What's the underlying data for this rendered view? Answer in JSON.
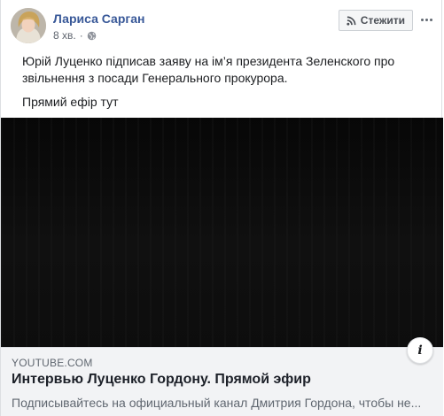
{
  "post": {
    "author": "Лариса Сарган",
    "timestamp": "8 хв.",
    "privacy_icon": "globe-icon",
    "follow_label": "Стежити",
    "follow_icon": "rss-icon",
    "more_icon": "more-icon",
    "text": "Юрій Луценко підписав заяву на ім’я президента Зеленского про звільнення з посади Генерального прокурора.",
    "text2": "Прямий ефір тут"
  },
  "link_preview": {
    "domain": "YOUTUBE.COM",
    "title": "Интервью Луценко Гордону. Прямой эфир",
    "description": "Подписывайтесь на официальный канал Дмитрия Гордона, чтобы не...",
    "info_icon": "info-icon",
    "info_glyph": "i"
  },
  "colors": {
    "author": "#385898",
    "text": "#1c1e21",
    "secondary": "#616770",
    "video_bg": "#0b0b0b",
    "link_box_bg": "#f2f3f5"
  }
}
